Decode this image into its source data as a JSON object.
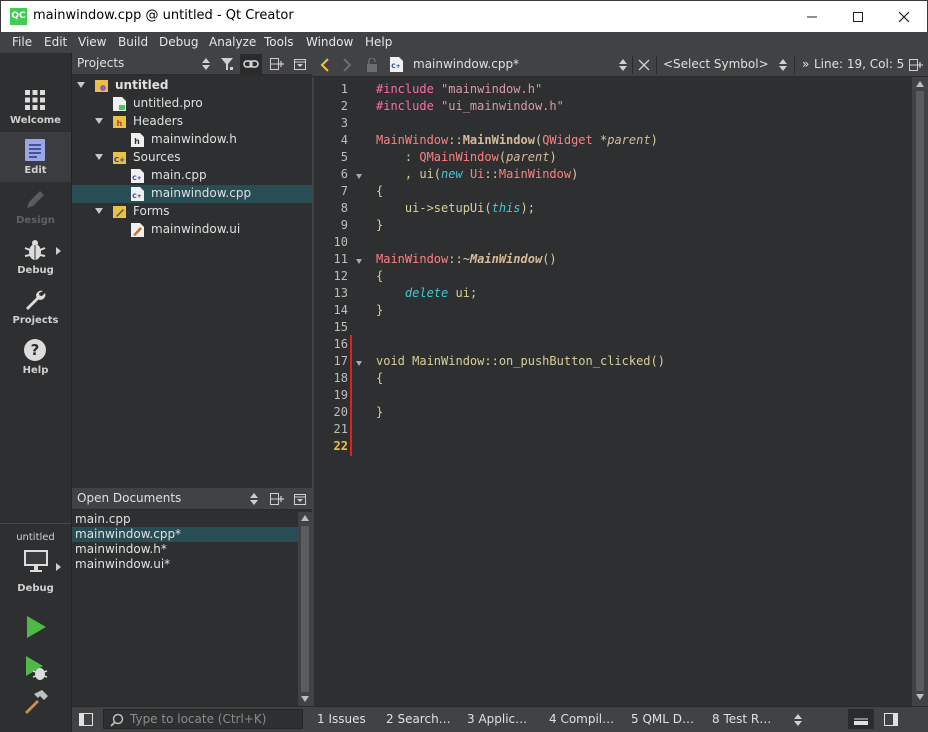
{
  "window": {
    "title": "mainwindow.cpp @ untitled - Qt Creator",
    "logo_text": "QC"
  },
  "menu": [
    "File",
    "Edit",
    "View",
    "Build",
    "Debug",
    "Analyze",
    "Tools",
    "Window",
    "Help"
  ],
  "modes": [
    {
      "label": "Welcome",
      "icon": "grid-icon"
    },
    {
      "label": "Edit",
      "icon": "edit-icon"
    },
    {
      "label": "Design",
      "icon": "pencil-icon"
    },
    {
      "label": "Debug",
      "icon": "bug-icon"
    },
    {
      "label": "Projects",
      "icon": "wrench-icon"
    },
    {
      "label": "Help",
      "icon": "question-icon"
    }
  ],
  "target": {
    "project": "untitled",
    "config": "Debug"
  },
  "projects_pane": {
    "title": "Projects",
    "tree": [
      {
        "label": "untitled",
        "bold": true
      },
      {
        "label": "untitled.pro"
      },
      {
        "label": "Headers"
      },
      {
        "label": "mainwindow.h"
      },
      {
        "label": "Sources"
      },
      {
        "label": "main.cpp"
      },
      {
        "label": "mainwindow.cpp",
        "selected": true
      },
      {
        "label": "Forms"
      },
      {
        "label": "mainwindow.ui"
      }
    ]
  },
  "open_documents": {
    "title": "Open Documents",
    "items": [
      "main.cpp",
      "mainwindow.cpp*",
      "mainwindow.h*",
      "mainwindow.ui*"
    ],
    "selected_index": 1
  },
  "editor": {
    "file_label": "mainwindow.cpp*",
    "symbol": "<Select Symbol>",
    "position": "Line: 19, Col: 5",
    "current_line": 22,
    "line_numbers": [
      "1",
      "2",
      "3",
      "4",
      "5",
      "6",
      "7",
      "8",
      "9",
      "10",
      "11",
      "12",
      "13",
      "14",
      "15",
      "16",
      "17",
      "18",
      "19",
      "20",
      "21",
      "22"
    ],
    "code": {
      "l1_pp": "#include ",
      "l1_str": "\"mainwindow.h\"",
      "l2_pp": "#include ",
      "l2_str": "\"ui_mainwindow.h\"",
      "l4_cls": "MainWindow",
      "l4_sep": "::",
      "l4_fn": "MainWindow",
      "l4_open": "(",
      "l4_cls2": "QWidget",
      "l4_rest": " *",
      "l4_par": "parent",
      "l4_close": ")",
      "l5_pre": "    : ",
      "l5_cls": "QMainWindow",
      "l5_open": "(",
      "l5_par": "parent",
      "l5_close": ")",
      "l6_pre": "    , ui(",
      "l6_kw": "new",
      "l6_sp": " ",
      "l6_ns": "Ui",
      "l6_sep": "::",
      "l6_cls": "MainWindow",
      "l6_close": ")",
      "l7": "{",
      "l8_pre": "    ui->setupUi(",
      "l8_kw": "this",
      "l8_close": ");",
      "l9": "}",
      "l11_cls": "MainWindow",
      "l11_sep": "::~",
      "l11_fn": "MainWindow",
      "l11_close": "()",
      "l12": "{",
      "l13_pre": "    ",
      "l13_kw": "delete",
      "l13_rest": " ui;",
      "l14": "}",
      "l17": "void MainWindow::on_pushButton_clicked()",
      "l18": "{",
      "l20": "}"
    }
  },
  "bottom": {
    "locator_placeholder": "Type to locate (Ctrl+K)",
    "tabs": [
      "1  Issues",
      "2  Search…",
      "3  Applic…",
      "4  Compil…",
      "5  QML D…",
      "8  Test R…"
    ]
  }
}
